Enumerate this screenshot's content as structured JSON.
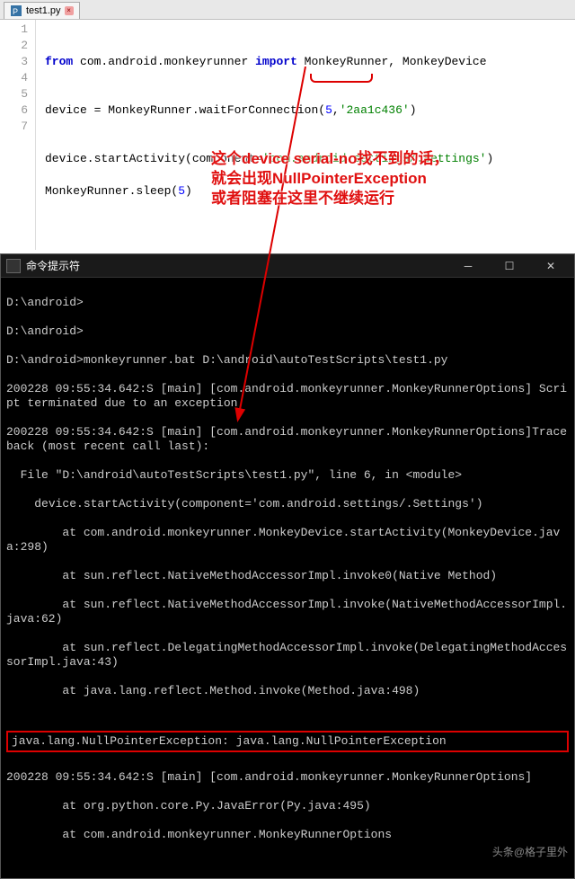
{
  "tab": {
    "label": "test1.py"
  },
  "code": {
    "line1": "",
    "line2_from": "from",
    "line2_pkg": " com.android.monkeyrunner ",
    "line2_import": "import",
    "line2_rest": " MonkeyRunner, MonkeyDevice",
    "line3": "",
    "line4_a": "device = MonkeyRunner.waitForConnection(",
    "line4_num": "5",
    "line4_b": ",",
    "line4_str": "'2aa1c436'",
    "line4_c": ")",
    "line5": "",
    "line6_a": "device.startActivity(component=",
    "line6_str": "'com.android.settings/.Settings'",
    "line6_b": ")",
    "line7_a": "MonkeyRunner.sleep(",
    "line7_num": "5",
    "line7_b": ")",
    "gutter": [
      "1",
      "2",
      "3",
      "4",
      "5",
      "6",
      "7"
    ]
  },
  "console": {
    "title": "命令提示符",
    "lines": [
      "D:\\android>",
      "D:\\android>",
      "D:\\android>monkeyrunner.bat D:\\android\\autoTestScripts\\test1.py",
      "200228 09:55:34.642:S [main] [com.android.monkeyrunner.MonkeyRunnerOptions] Script terminated due to an exception",
      "200228 09:55:34.642:S [main] [com.android.monkeyrunner.MonkeyRunnerOptions]Traceback (most recent call last):",
      "  File \"D:\\android\\autoTestScripts\\test1.py\", line 6, in <module>",
      "    device.startActivity(component='com.android.settings/.Settings')",
      "        at com.android.monkeyrunner.MonkeyDevice.startActivity(MonkeyDevice.java:298)",
      "        at sun.reflect.NativeMethodAccessorImpl.invoke0(Native Method)",
      "        at sun.reflect.NativeMethodAccessorImpl.invoke(NativeMethodAccessorImpl.java:62)",
      "        at sun.reflect.DelegatingMethodAccessorImpl.invoke(DelegatingMethodAccessorImpl.java:43)",
      "        at java.lang.reflect.Method.invoke(Method.java:498)",
      ""
    ],
    "npe": "java.lang.NullPointerException: java.lang.NullPointerException",
    "after": [
      "200228 09:55:34.642:S [main] [com.android.monkeyrunner.MonkeyRunnerOptions]",
      "        at org.python.core.Py.JavaError(Py.java:495)",
      "        at com.android.monkeyrunner.MonkeyRunnerOptions"
    ]
  },
  "annotation": {
    "l1": "这个device serial-no找不到的话，",
    "l2": "就会出现NullPointerException",
    "l3": "或者阻塞在这里不继续运行"
  },
  "watermark": "头条@格子里外"
}
